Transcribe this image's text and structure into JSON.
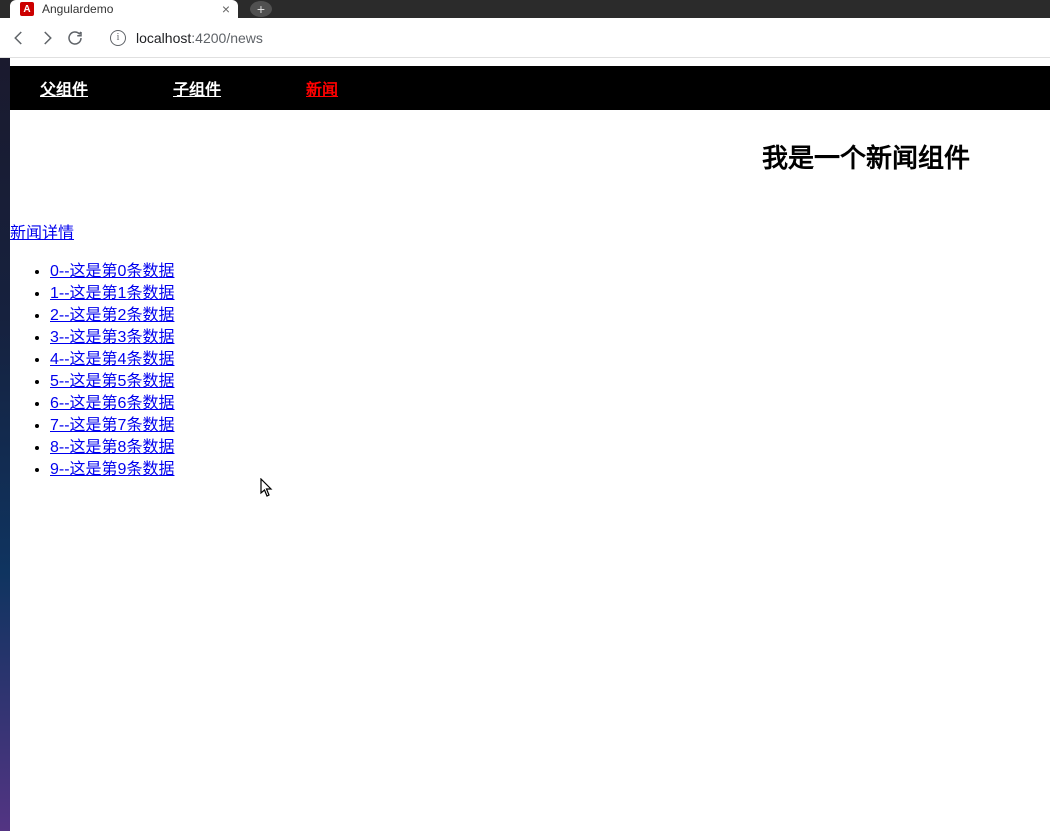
{
  "browser": {
    "tab_title": "Angulardemo",
    "tab_favicon_letter": "A",
    "url_host": "localhost",
    "url_port": ":4200",
    "url_path": "/news"
  },
  "nav": {
    "items": [
      {
        "label": "父组件",
        "active": false
      },
      {
        "label": "子组件",
        "active": false
      },
      {
        "label": "新闻",
        "active": true
      }
    ]
  },
  "page_title": "我是一个新闻组件",
  "news_detail_label": "新闻详情",
  "news_items": [
    "0--这是第0条数据",
    "1--这是第1条数据",
    "2--这是第2条数据",
    "3--这是第3条数据",
    "4--这是第4条数据",
    "5--这是第5条数据",
    "6--这是第6条数据",
    "7--这是第7条数据",
    "8--这是第8条数据",
    "9--这是第9条数据"
  ]
}
